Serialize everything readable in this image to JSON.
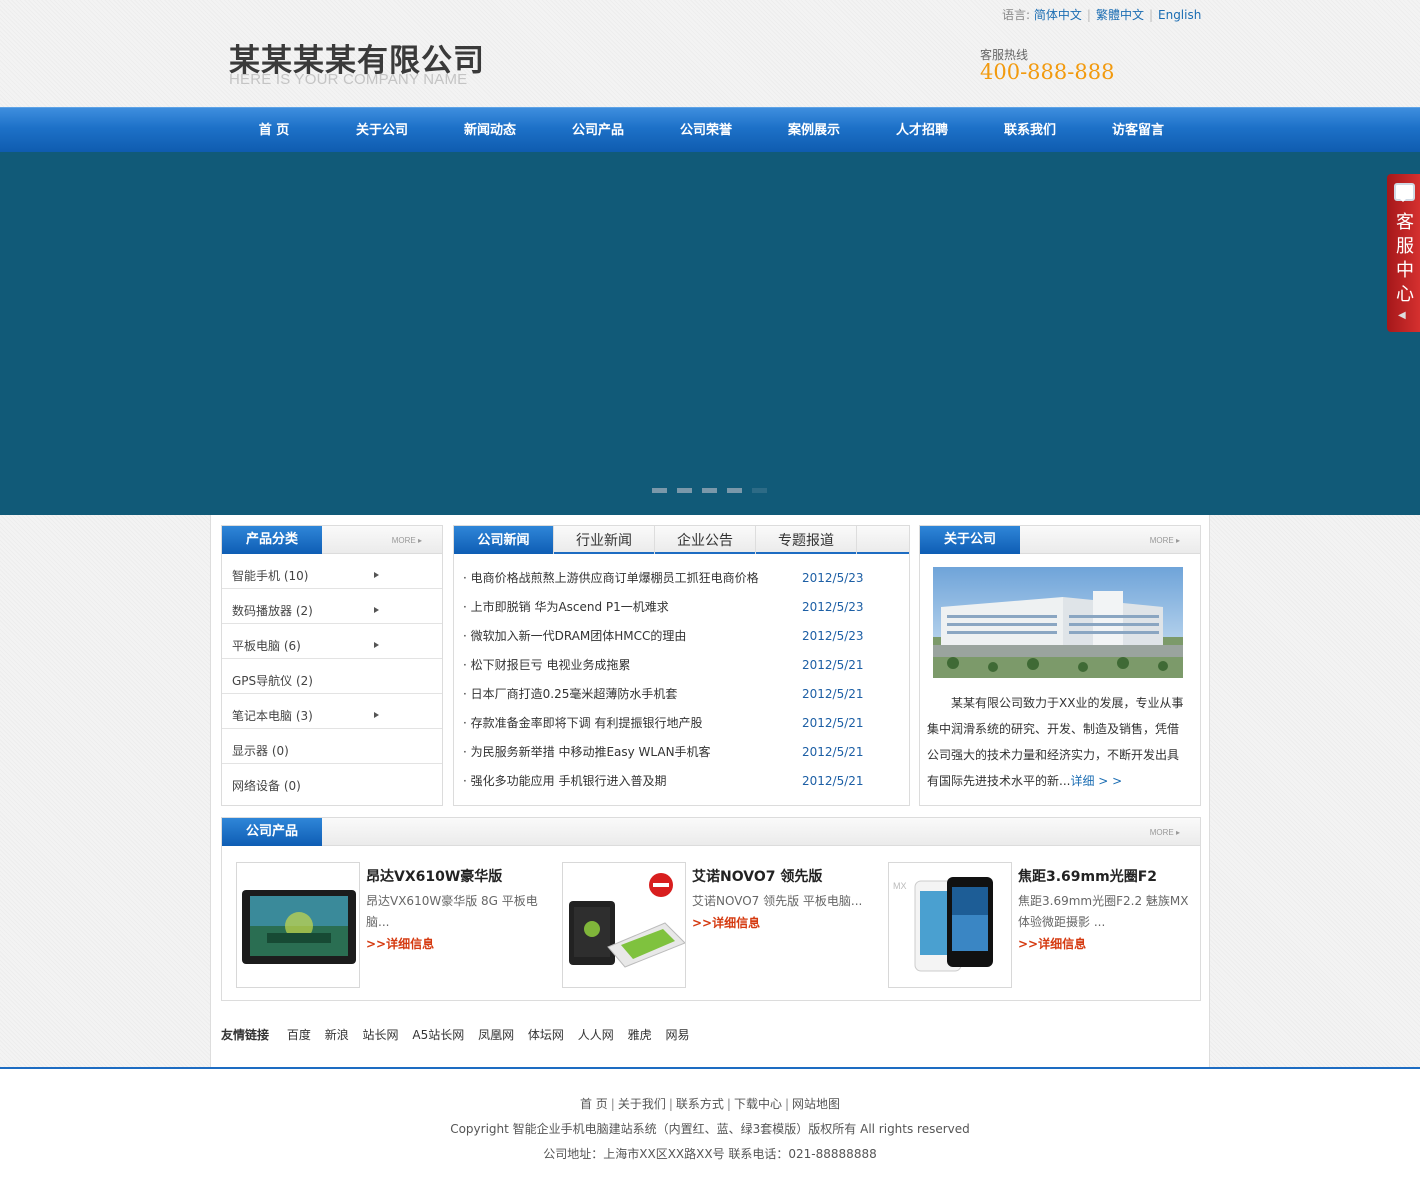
{
  "header": {
    "company_cn": "某某某某有限公司",
    "company_en": "HERE IS YOUR COMPANY NAME",
    "lang_label": "语言:",
    "langs": [
      "简体中文",
      "繁體中文",
      "English"
    ],
    "hotline_label": "客服热线",
    "hotline": "400-888-888"
  },
  "nav": [
    "首 页",
    "关于公司",
    "新闻动态",
    "公司产品",
    "公司荣誉",
    "案例展示",
    "人才招聘",
    "联系我们",
    "访客留言"
  ],
  "banner": {
    "color": "#115a78",
    "slides": 5,
    "active_slide": 5
  },
  "service": {
    "label": "客服中心",
    "arrow": "◀"
  },
  "categories": {
    "title": "产品分类",
    "more": "MORE ▸",
    "items": [
      {
        "label": "智能手机 (10)",
        "arrow": true
      },
      {
        "label": "数码播放器 (2)",
        "arrow": true
      },
      {
        "label": "平板电脑 (6)",
        "arrow": true
      },
      {
        "label": "GPS导航仪 (2)",
        "arrow": false
      },
      {
        "label": "笔记本电脑 (3)",
        "arrow": true
      },
      {
        "label": "显示器 (0)",
        "arrow": false
      },
      {
        "label": "网络设备 (0)",
        "arrow": false
      }
    ]
  },
  "news": {
    "tabs": [
      "公司新闻",
      "行业新闻",
      "企业公告",
      "专题报道"
    ],
    "items": [
      {
        "title": "· 电商价格战煎熬上游供应商订单爆棚员工抓狂电商价格",
        "date": "2012/5/23"
      },
      {
        "title": "· 上市即脱销 华为Ascend P1一机难求",
        "date": "2012/5/23"
      },
      {
        "title": "· 微软加入新一代DRAM团体HMCC的理由",
        "date": "2012/5/23"
      },
      {
        "title": "· 松下财报巨亏 电视业务成拖累",
        "date": "2012/5/21"
      },
      {
        "title": "· 日本厂商打造0.25毫米超薄防水手机套",
        "date": "2012/5/21"
      },
      {
        "title": "· 存款准备金率即将下调 有利提振银行地产股",
        "date": "2012/5/21"
      },
      {
        "title": "· 为民服务新举措 中移动推Easy WLAN手机客",
        "date": "2012/5/21"
      },
      {
        "title": "· 强化多功能应用 手机银行进入普及期",
        "date": "2012/5/21"
      }
    ]
  },
  "about": {
    "title": "关于公司",
    "more": "MORE ▸",
    "text": "某某有限公司致力于XX业的发展，专业从事集中润滑系统的研究、开发、制造及销售，凭借公司强大的技术力量和经济实力，不断开发出具有国际先进技术水平的新...",
    "detail": "详细 > >"
  },
  "products": {
    "title": "公司产品",
    "more": "MORE ▸",
    "items": [
      {
        "name": "昂达VX610W豪华版",
        "desc": "昂达VX610W豪华版 8G 平板电脑...",
        "link": ">>详细信息"
      },
      {
        "name": "艾诺NOVO7 领先版",
        "desc": "艾诺NOVO7 领先版 平板电脑...",
        "link": ">>详细信息"
      },
      {
        "name": "焦距3.69mm光圈F2",
        "desc": "焦距3.69mm光圈F2.2 魅族MX体验微距摄影 ...",
        "link": ">>详细信息"
      }
    ]
  },
  "friend_links": {
    "label": "友情链接",
    "items": [
      "百度",
      "新浪",
      "站长网",
      "A5站长网",
      "凤凰网",
      "体坛网",
      "人人网",
      "雅虎",
      "网易"
    ]
  },
  "footer": {
    "links": [
      "首 页",
      "关于我们",
      "联系方式",
      "下载中心",
      "网站地图"
    ],
    "copyright": "Copyright 智能企业手机电脑建站系统（内置红、蓝、绿3套模版）版权所有 All rights reserved",
    "address": "公司地址：上海市XX区XX路XX号 联系电话：021-88888888"
  }
}
